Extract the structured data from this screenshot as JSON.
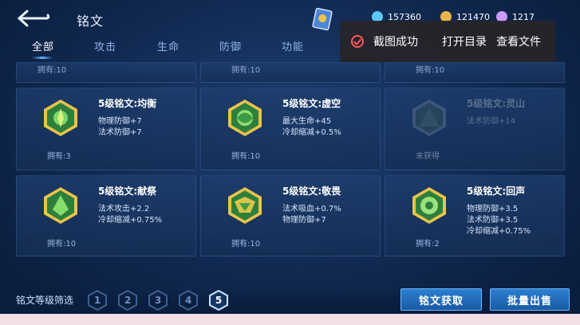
{
  "header": {
    "title": "铭文",
    "tabs": [
      {
        "label": "全部",
        "active": true
      },
      {
        "label": "攻击",
        "active": false
      },
      {
        "label": "生命",
        "active": false
      },
      {
        "label": "防御",
        "active": false
      },
      {
        "label": "功能",
        "active": false
      }
    ],
    "resources": [
      {
        "icon": "ticket-icon",
        "value": "157360"
      },
      {
        "icon": "gold-coin-icon",
        "value": "121470"
      },
      {
        "icon": "crystal-icon",
        "value": "1217"
      }
    ]
  },
  "toast": {
    "message": "截图成功",
    "open_dir": "打开目录",
    "view_file": "查看文件"
  },
  "partial_row": [
    "拥有:10",
    "拥有:10",
    "拥有:10"
  ],
  "cards": [
    {
      "name": "5级铭文:均衡",
      "stats": [
        "物理防御+7",
        "法术防御+7"
      ],
      "owned": "拥有:3",
      "obtained": true
    },
    {
      "name": "5级铭文:虚空",
      "stats": [
        "最大生命+45",
        "冷却缩减+0.5%"
      ],
      "owned": "拥有:10",
      "obtained": true
    },
    {
      "name": "5级铭文:灵山",
      "stats": [
        "法术防御+14"
      ],
      "owned": "未获得",
      "obtained": false
    },
    {
      "name": "5级铭文:献祭",
      "stats": [
        "法术攻击+2.2",
        "冷却缩减+0.75%"
      ],
      "owned": "拥有:10",
      "obtained": true
    },
    {
      "name": "5级铭文:敬畏",
      "stats": [
        "法术吸血+0.7%",
        "物理防御+7"
      ],
      "owned": "拥有:10",
      "obtained": true
    },
    {
      "name": "5级铭文:回声",
      "stats": [
        "物理防御+3.5",
        "法术防御+3.5",
        "冷却缩减+0.75%"
      ],
      "owned": "拥有:2",
      "obtained": true
    }
  ],
  "footer": {
    "filter_label": "铭文等级筛选",
    "levels": [
      "1",
      "2",
      "3",
      "4",
      "5"
    ],
    "active_level": "5",
    "acquire_button": "铭文获取",
    "sell_button": "批量出售"
  }
}
